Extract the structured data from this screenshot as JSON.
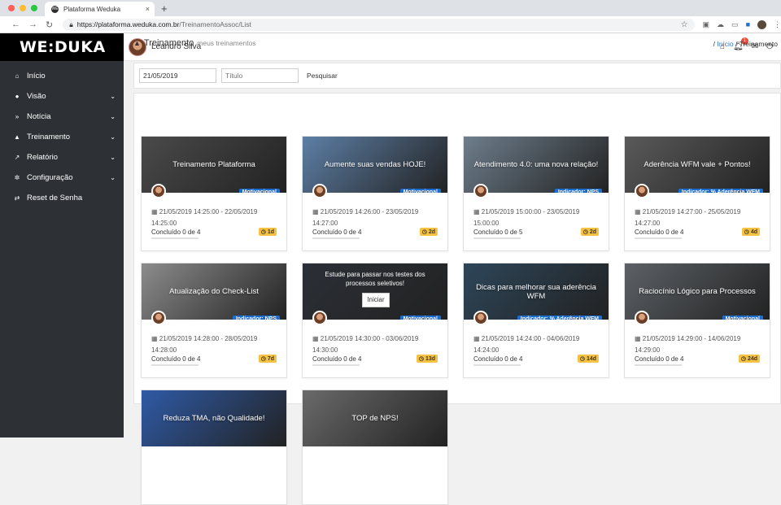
{
  "browser": {
    "tab_title": "Plataforma Weduka",
    "tab_favicon": "WE",
    "url_host": "https://plataforma.weduka.com.br",
    "url_path": "/TreinamentoAssoc/List"
  },
  "sidebar": {
    "logo": "WE:DUKA",
    "items": [
      {
        "label": "Início",
        "icon": "home-icon",
        "glyph": "⌂",
        "has_sub": false
      },
      {
        "label": "Visão",
        "icon": "user-icon",
        "glyph": "●",
        "has_sub": true
      },
      {
        "label": "Notícia",
        "icon": "rss-icon",
        "glyph": "»",
        "has_sub": true
      },
      {
        "label": "Treinamento",
        "icon": "graduation-cap-icon",
        "glyph": "▲",
        "has_sub": true
      },
      {
        "label": "Relatório",
        "icon": "line-chart-icon",
        "glyph": "↗",
        "has_sub": true
      },
      {
        "label": "Configuração",
        "icon": "cogs-icon",
        "glyph": "✲",
        "has_sub": true
      },
      {
        "label": "Reset de Senha",
        "icon": "exchange-icon",
        "glyph": "⇄",
        "has_sub": false
      }
    ]
  },
  "header": {
    "username": "Leandro Silva",
    "notif_count": "1"
  },
  "page": {
    "title": "Treinamento",
    "subtitle": "meus treinamentos",
    "breadcrumb_home": "Início",
    "breadcrumb_current": "Treinamento"
  },
  "filters": {
    "date_value": "21/05/2019",
    "title_placeholder": "Título",
    "search_label": "Pesquisar"
  },
  "cards": [
    {
      "title": "Treinamento Plataforma",
      "tag": "Motivacional",
      "date_range": "21/05/2019 14:25:00 - 22/05/2019",
      "time": "14:25:00",
      "progress": "Concluído 0 de 4",
      "days": "1d",
      "bg": "#4a4a4a"
    },
    {
      "title": "Aumente suas vendas HOJE!",
      "tag": "Motivacional",
      "date_range": "21/05/2019 14:26:00 - 23/05/2019",
      "time": "14:27:00",
      "progress": "Concluído 0 de 4",
      "days": "2d",
      "bg": "#5d7fa6"
    },
    {
      "title": "Atendimento 4.0: uma nova relação!",
      "tag": "Indicador: NPS",
      "date_range": "21/05/2019 15:00:00 - 23/05/2019",
      "time": "15:00:00",
      "progress": "Concluído 0 de 5",
      "days": "2d",
      "bg": "#6e7e8c"
    },
    {
      "title": "Aderência WFM vale + Pontos!",
      "tag": "Indicador: % Aderência WFM",
      "date_range": "21/05/2019 14:27:00 - 25/05/2019",
      "time": "14:27:00",
      "progress": "Concluído 0 de 4",
      "days": "4d",
      "bg": "#5a5a5a"
    },
    {
      "title": "Atualização do Check-List",
      "tag": "Indicador: NPS",
      "date_range": "21/05/2019 14:28:00 - 28/05/2019",
      "time": "14:28:00",
      "progress": "Concluído 0 de 4",
      "days": "7d",
      "bg": "#8c8c8c"
    },
    {
      "title": "",
      "overlay": "Estude para passar nos testes dos processos seletivos!",
      "button": "Iniciar",
      "tag": "Motivacional",
      "date_range": "21/05/2019 14:30:00 - 03/06/2019",
      "time": "14:30:00",
      "progress": "Concluído 0 de 4",
      "days": "13d",
      "bg": "#2b2f36"
    },
    {
      "title": "Dicas para melhorar sua aderência WFM",
      "tag": "Indicador: % Aderência WFM",
      "date_range": "21/05/2019 14:24:00 - 04/06/2019",
      "time": "14:24:00",
      "progress": "Concluído 0 de 4",
      "days": "14d",
      "bg": "#2d4659"
    },
    {
      "title": "Raciocínio Lógico para Processos",
      "tag": "Motivacional",
      "date_range": "21/05/2019 14:29:00 - 14/06/2019",
      "time": "14:29:00",
      "progress": "Concluído 0 de 4",
      "days": "24d",
      "bg": "#5c6166"
    },
    {
      "title": "Reduza TMA, não Qualidade!",
      "bg": "#2f5aa6"
    },
    {
      "title": "TOP de NPS!",
      "bg": "#6a6a6a"
    }
  ],
  "colors": {
    "sidebar_bg": "#2d3035",
    "tag_blue": "#1c6fd3",
    "days_badge": "#f5c242",
    "link": "#2a7ad2"
  }
}
